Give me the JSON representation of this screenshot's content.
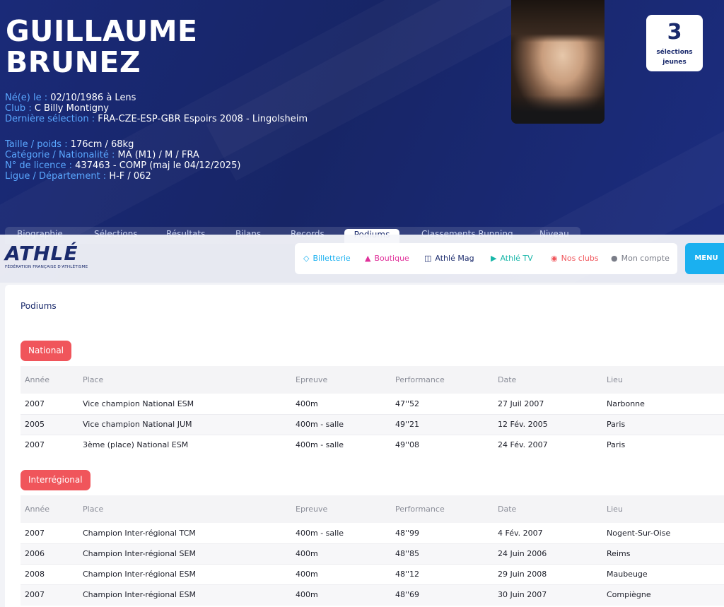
{
  "athlete": {
    "first_name": "GUILLAUME",
    "last_name": "BRUNEZ",
    "birth_label": "Né(e) le :",
    "birth_value": "02/10/1986 à Lens",
    "club_label": "Club :",
    "club_value": "C Billy Montigny",
    "last_selection_label": "Dernière sélection :",
    "last_selection_value": "FRA-CZE-ESP-GBR Espoirs 2008 - Lingolsheim",
    "size_label": "Taille / poids :",
    "size_value": "176cm / 68kg",
    "category_label": "Catégorie / Nationalité :",
    "category_value": "MA (M1) / M / FRA",
    "license_label": "N° de licence :",
    "license_value": "437463 - COMP  (maj le 04/12/2025)",
    "league_label": "Ligue / Département :",
    "league_value": "H-F / 062"
  },
  "selections": {
    "count": "3",
    "label_line1": "sélections",
    "label_line2": "jeunes"
  },
  "tabs": [
    "Biographie",
    "Sélections",
    "Résultats",
    "Bilans",
    "Records",
    "Podiums",
    "Classements Running",
    "Niveau"
  ],
  "active_tab": "Podiums",
  "logo": {
    "word": "ATHLÉ",
    "subtitle": "FÉDÉRATION FRANÇAISE D'ATHLÉTISME"
  },
  "nav": {
    "billetterie": "Billetterie",
    "boutique": "Boutique",
    "athle_mag": "Athlé Mag",
    "athle_tv": "Athlé TV",
    "nos_clubs": "Nos clubs",
    "mon_compte": "Mon compte",
    "menu": "MENU"
  },
  "colors": {
    "hero_bg": "#172566",
    "billetterie": "#1ab0f0",
    "boutique": "#e0309a",
    "athle_mag": "#1a2a6c",
    "athle_tv": "#17b6a8",
    "nos_clubs": "#f0555b",
    "mon_compte": "#7a7d88",
    "badge": "#f0555b",
    "menu": "#1ab0f0"
  },
  "section_title": "Podiums",
  "columns": [
    "Année",
    "Place",
    "Epreuve",
    "Performance",
    "Date",
    "Lieu"
  ],
  "groups": [
    {
      "label": "National",
      "rows": [
        [
          "2007",
          "Vice champion National ESM",
          "400m",
          "47''52",
          "27 Juil 2007",
          "Narbonne"
        ],
        [
          "2005",
          "Vice champion National JUM",
          "400m - salle",
          "49''21",
          "12 Fév. 2005",
          "Paris"
        ],
        [
          "2007",
          "3ème (place) National ESM",
          "400m - salle",
          "49''08",
          "24 Fév. 2007",
          "Paris"
        ]
      ]
    },
    {
      "label": "Interrégional",
      "rows": [
        [
          "2007",
          "Champion Inter-régional TCM",
          "400m - salle",
          "48''99",
          "4 Fév. 2007",
          "Nogent-Sur-Oise"
        ],
        [
          "2006",
          "Champion Inter-régional SEM",
          "400m",
          "48''85",
          "24 Juin 2006",
          "Reims"
        ],
        [
          "2008",
          "Champion Inter-régional ESM",
          "400m",
          "48''12",
          "29 Juin 2008",
          "Maubeuge"
        ],
        [
          "2007",
          "Champion Inter-régional ESM",
          "400m",
          "48''69",
          "30 Juin 2007",
          "Compiègne"
        ]
      ]
    }
  ]
}
